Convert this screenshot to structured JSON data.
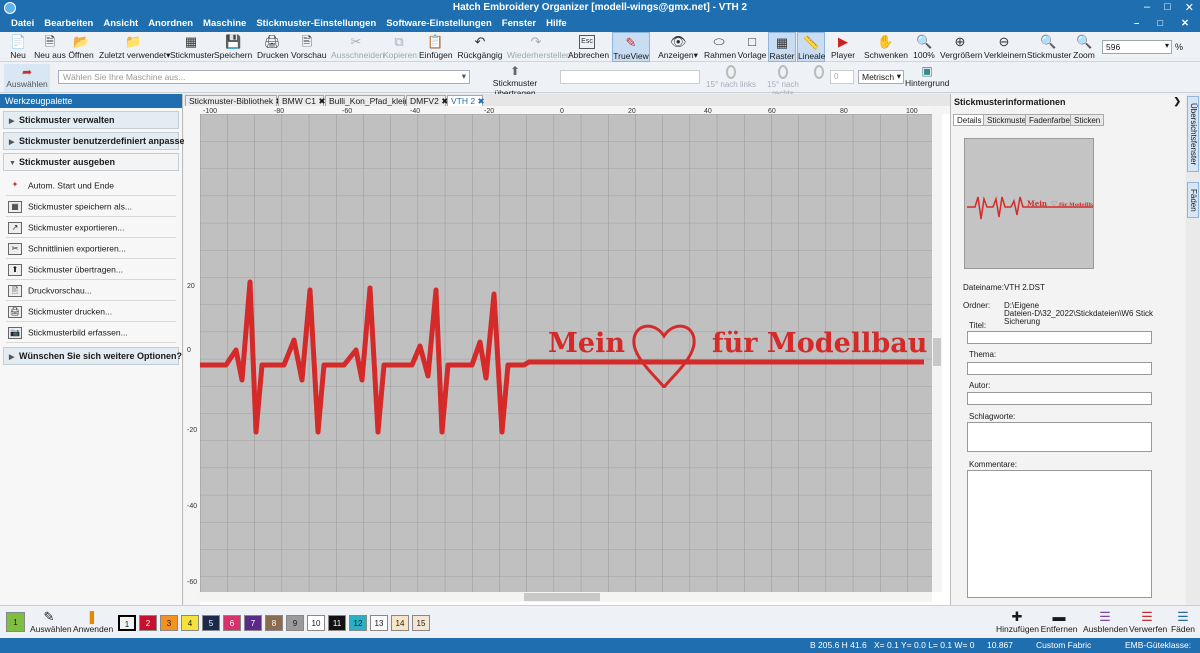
{
  "window": {
    "title": "Hatch Embroidery Organizer [modell-wings@gmx.net] - VTH 2"
  },
  "menu": [
    "Datei",
    "Bearbeiten",
    "Ansicht",
    "Anordnen",
    "Maschine",
    "Stickmuster-Einstellungen",
    "Software-Einstellungen",
    "Fenster",
    "Hilfe"
  ],
  "toolbar": [
    {
      "label": "Neu",
      "icon": "new-file-icon"
    },
    {
      "label": "Neu aus",
      "icon": "new-from-icon"
    },
    {
      "label": "Öffnen",
      "icon": "open-folder-icon"
    },
    {
      "label": "Zuletzt verwendet",
      "icon": "recent-folder-icon"
    },
    {
      "label": "Stickmuster",
      "icon": "design-icon"
    },
    {
      "label": "Speichern",
      "icon": "save-icon"
    },
    {
      "label": "Drucken",
      "icon": "print-icon"
    },
    {
      "label": "Vorschau",
      "icon": "preview-icon"
    },
    {
      "label": "Ausschneiden",
      "icon": "cut-icon"
    },
    {
      "label": "Kopieren",
      "icon": "copy-icon"
    },
    {
      "label": "Einfügen",
      "icon": "paste-icon"
    },
    {
      "label": "Rückgängig",
      "icon": "undo-icon"
    },
    {
      "label": "Wiederherstellen",
      "icon": "redo-icon"
    },
    {
      "label": "Abbrechen",
      "icon": "esc-icon"
    },
    {
      "label": "TrueView",
      "icon": "trueview-icon"
    },
    {
      "label": "Anzeigen",
      "icon": "show-icon"
    },
    {
      "label": "Rahmen",
      "icon": "hoop-icon"
    },
    {
      "label": "Vorlage",
      "icon": "template-icon"
    },
    {
      "label": "Raster",
      "icon": "grid-icon"
    },
    {
      "label": "Lineale",
      "icon": "ruler-icon"
    },
    {
      "label": "Player",
      "icon": "play-icon"
    },
    {
      "label": "Schwenken",
      "icon": "pan-hand-icon"
    },
    {
      "label": "100%",
      "icon": "zoom-100-icon"
    },
    {
      "label": "Vergrößern",
      "icon": "zoom-in-icon"
    },
    {
      "label": "Verkleinern",
      "icon": "zoom-out-icon"
    },
    {
      "label": "Stickmuster",
      "icon": "zoom-design-icon"
    },
    {
      "label": "Zoom",
      "icon": "zoom-icon"
    }
  ],
  "zoom": {
    "value": "596",
    "unit": "%"
  },
  "toolbar2": {
    "auswaehlen": "Auswählen",
    "machine_placeholder": "Wählen Sie Ihre Maschine aus...",
    "uebertragen": "Stickmuster übertragen",
    "rotate_left": "15° nach links",
    "rotate_right": "15° nach rechts",
    "angle": "0",
    "units": "Metrisch",
    "hintergrund": "Hintergrund"
  },
  "left_panel": {
    "title": "Werkzeugpalette",
    "sections": [
      "Stickmuster verwalten",
      "Stickmuster benutzerdefiniert anpassen",
      "Stickmuster ausgeben"
    ],
    "items": [
      {
        "label": "Autom. Start und Ende",
        "icon": "start-end-icon"
      },
      {
        "label": "Stickmuster speichern als...",
        "icon": "save-as-icon"
      },
      {
        "label": "Stickmuster exportieren...",
        "icon": "export-icon"
      },
      {
        "label": "Schnittlinien exportieren...",
        "icon": "cutlines-icon"
      },
      {
        "label": "Stickmuster übertragen...",
        "icon": "transfer-icon"
      },
      {
        "label": "Druckvorschau...",
        "icon": "print-preview-icon"
      },
      {
        "label": "Stickmuster drucken...",
        "icon": "print-icon"
      },
      {
        "label": "Stickmusterbild erfassen...",
        "icon": "camera-icon"
      }
    ],
    "footer": "Wünschen Sie sich weitere Optionen?"
  },
  "doc_tabs": [
    "Stickmuster-Bibliothek",
    "BMW C1",
    "Bulli_Kon_Pfad_klein",
    "DMFV2",
    "VTH 2"
  ],
  "canvas": {
    "ruler_top": [
      "-100",
      "-80",
      "-60",
      "-40",
      "-20",
      "0",
      "20",
      "40",
      "60",
      "80",
      "100"
    ],
    "ruler_left": [
      "20",
      "0",
      "-20",
      "-40",
      "-60"
    ],
    "design_text": "Mein für Modellbau",
    "thread_color": "#d42a2a",
    "bg_color": "#c0c0c0"
  },
  "right_panel": {
    "title": "Stickmusterinformationen",
    "tabs": [
      "Details",
      "Stickmuster",
      "Fadenfarben",
      "Sticken"
    ],
    "dateiname_label": "Dateiname:",
    "dateiname": "VTH 2.DST",
    "ordner_label": "Ordner:",
    "ordner": [
      "D:\\Eigene",
      "Dateien-D\\32_2022\\Stickdateien\\W6 Stick",
      "Sicherung"
    ],
    "fields": [
      "Titel:",
      "Thema:",
      "Autor:",
      "Schlagworte:",
      "Kommentare:"
    ]
  },
  "vertical_tabs": [
    "Übersichtsfenster",
    "Fäden"
  ],
  "palette": {
    "current": "1",
    "swatches": [
      {
        "n": "1",
        "color": "#f2f2f2"
      },
      {
        "n": "2",
        "color": "#c8102e"
      },
      {
        "n": "3",
        "color": "#f39221"
      },
      {
        "n": "4",
        "color": "#f5e33c"
      },
      {
        "n": "5",
        "color": "#1b2a4a"
      },
      {
        "n": "6",
        "color": "#d6336c"
      },
      {
        "n": "7",
        "color": "#5b2a86"
      },
      {
        "n": "8",
        "color": "#8b6a4f"
      },
      {
        "n": "9",
        "color": "#9a9a9a"
      },
      {
        "n": "10",
        "color": "#ffffff"
      },
      {
        "n": "11",
        "color": "#111111"
      },
      {
        "n": "12",
        "color": "#2ab0c5"
      },
      {
        "n": "13",
        "color": "#fbfbfb"
      },
      {
        "n": "14",
        "color": "#f7e6c4"
      },
      {
        "n": "15",
        "color": "#f5e6d3"
      }
    ],
    "auswaehlen": "Auswählen",
    "anwenden": "Anwenden",
    "hinzufuegen": "Hinzufügen",
    "entfernen": "Entfernen",
    "ausblenden": "Ausblenden",
    "verwerfen": "Verwerfen",
    "faeden": "Fäden",
    "first_swatch_color": "#7fbf3f"
  },
  "status": {
    "dims": "B 205.6 H  41.6",
    "coords": "X=   0.1 Y=   0.0 L=   0.1 W=    0",
    "stitches": "10.867",
    "fabric": "Custom Fabric",
    "quality": "EMB-Güteklasse:"
  }
}
